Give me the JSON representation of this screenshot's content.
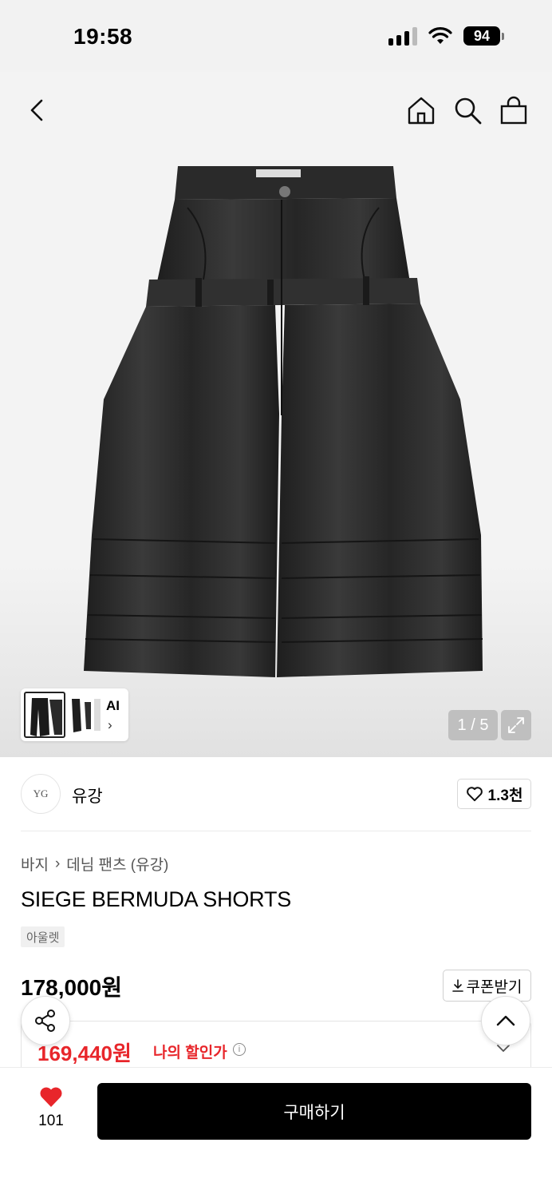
{
  "status": {
    "time": "19:58",
    "battery": "94"
  },
  "gallery": {
    "thumb_label": "AI",
    "thumb_chevron": "›",
    "page": "1 / 5"
  },
  "icons": {
    "back": "chevron-left-icon",
    "home": "home-icon",
    "search": "search-icon",
    "cart": "shopping-bag-icon",
    "expand": "expand-icon",
    "heart": "heart-icon",
    "share": "share-icon",
    "up": "chevron-up-icon",
    "download": "download-icon",
    "info": "info-icon"
  },
  "brand": {
    "logo_text": "YG",
    "name": "유강",
    "likes": "1.3천"
  },
  "breadcrumb": {
    "category": "바지",
    "separator": "›",
    "subcategory": "데님 팬츠 (유강)"
  },
  "product": {
    "title": "SIEGE BERMUDA SHORTS",
    "badge": "아울렛",
    "price": "178,000원"
  },
  "coupon": {
    "label": "쿠폰받기"
  },
  "discount": {
    "price": "169,440원",
    "label": "나의 할인가",
    "info": "i"
  },
  "bottom": {
    "like_count": "101",
    "buy_label": "구매하기"
  },
  "colors": {
    "accent_red": "#e8262b",
    "heart_red": "#e8262b",
    "button_black": "#000000"
  }
}
